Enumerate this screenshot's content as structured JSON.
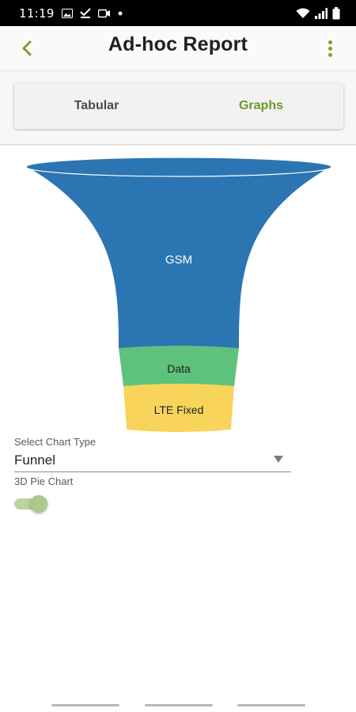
{
  "status_bar": {
    "time": "11:19",
    "left_icons": [
      "image-icon",
      "check-download-icon",
      "video-icon",
      "dot-icon"
    ],
    "right_icons": [
      "wifi-icon",
      "signal-icon",
      "battery-icon"
    ]
  },
  "app_bar": {
    "title": "Ad-hoc Report",
    "back_icon": "chevron-left-icon",
    "menu_icon": "more-vert-icon",
    "accent_color": "#7aa22e"
  },
  "tabs": [
    {
      "label": "Tabular",
      "selected": false
    },
    {
      "label": "Graphs",
      "selected": true
    }
  ],
  "chart_data": {
    "type": "funnel",
    "categories": [
      "GSM",
      "Data",
      "LTE Fixed"
    ],
    "colors": [
      "#2b75b3",
      "#5ec27d",
      "#f8d55a"
    ]
  },
  "controls": {
    "chart_type_label": "Select Chart Type",
    "chart_type_value": "Funnel",
    "toggle_label": "3D Pie Chart",
    "toggle_on": true
  }
}
